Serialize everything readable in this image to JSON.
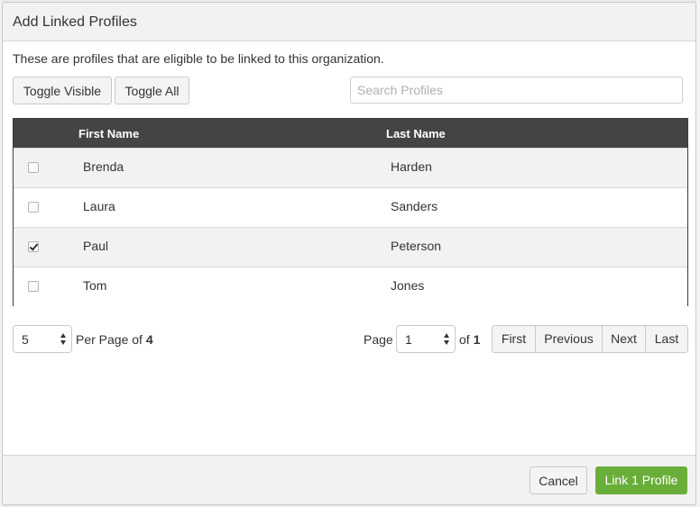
{
  "modal": {
    "title": "Add Linked Profiles",
    "description": "These are profiles that are eligible to be linked to this organization."
  },
  "toolbar": {
    "toggle_visible_label": "Toggle Visible",
    "toggle_all_label": "Toggle All",
    "search_placeholder": "Search Profiles",
    "search_value": ""
  },
  "table": {
    "columns": [
      "First Name",
      "Last Name"
    ],
    "rows": [
      {
        "first": "Brenda",
        "last": "Harden",
        "checked": false
      },
      {
        "first": "Laura",
        "last": "Sanders",
        "checked": false
      },
      {
        "first": "Paul",
        "last": "Peterson",
        "checked": true
      },
      {
        "first": "Tom",
        "last": "Jones",
        "checked": false
      }
    ]
  },
  "pagination": {
    "per_page_value": "5",
    "per_page_label": "Per Page of",
    "total_count": "4",
    "page_label": "Page",
    "page_value": "1",
    "of_label": "of",
    "total_pages": "1",
    "first_label": "First",
    "previous_label": "Previous",
    "next_label": "Next",
    "last_label": "Last"
  },
  "footer": {
    "cancel_label": "Cancel",
    "link_label": "Link 1 Profile"
  },
  "colors": {
    "primary_green": "#6aae3a",
    "header_dark": "#444444"
  }
}
